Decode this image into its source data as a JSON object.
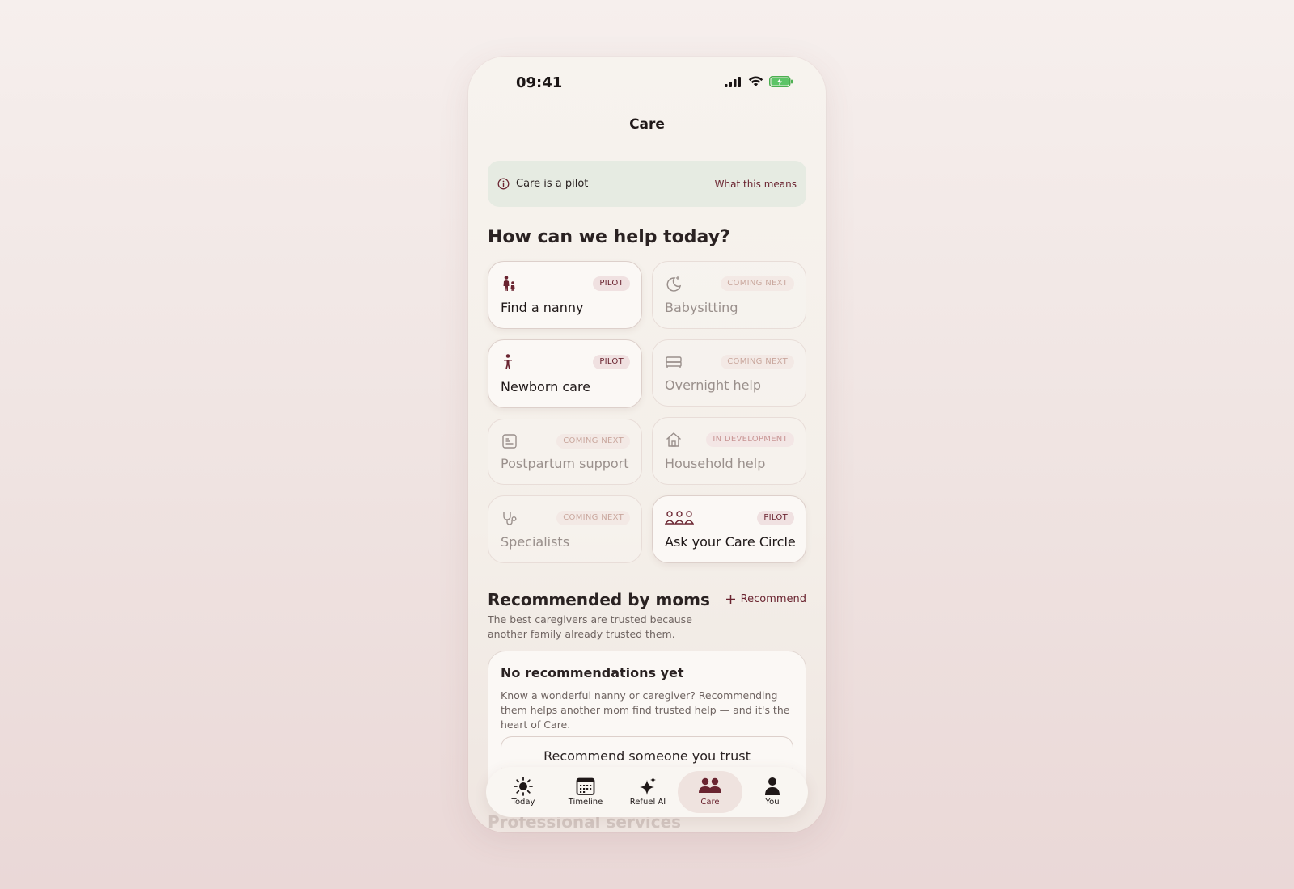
{
  "status_bar": {
    "time": "09:41"
  },
  "nav": {
    "title": "Care"
  },
  "banner": {
    "text": "Care is a pilot",
    "link": "What this means"
  },
  "help": {
    "heading": "How can we help today?",
    "cards": [
      {
        "label": "Find a nanny",
        "badge": "PILOT",
        "icon": "nanny-icon",
        "state": "active"
      },
      {
        "label": "Babysitting",
        "badge": "COMING NEXT",
        "icon": "moon-icon",
        "state": "muted"
      },
      {
        "label": "Newborn care",
        "badge": "PILOT",
        "icon": "newborn-icon",
        "state": "active"
      },
      {
        "label": "Overnight help",
        "badge": "COMING NEXT",
        "icon": "bed-icon",
        "state": "muted"
      },
      {
        "label": "Postpartum support",
        "badge": "COMING NEXT",
        "icon": "document-icon",
        "state": "muted"
      },
      {
        "label": "Household help",
        "badge": "IN DEVELOPMENT",
        "icon": "house-icon",
        "state": "muted"
      },
      {
        "label": "Specialists",
        "badge": "COMING NEXT",
        "icon": "stethoscope-icon",
        "state": "muted"
      },
      {
        "label": "Ask your Care Circle",
        "badge": "PILOT",
        "icon": "group-icon",
        "state": "active"
      }
    ]
  },
  "recommended": {
    "heading": "Recommended by moms",
    "subtitle": "The best caregivers are trusted because another family already trusted them.",
    "action": "Recommend",
    "empty_title": "No recommendations yet",
    "empty_body": "Know a wonderful nanny or caregiver? Recommending them helps another mom find trusted help — and it's the heart of Care.",
    "empty_button": "Recommend someone you trust"
  },
  "next_section": {
    "heading": "Professional services"
  },
  "tabs": [
    {
      "label": "Today",
      "icon": "sun-icon"
    },
    {
      "label": "Timeline",
      "icon": "calendar-icon"
    },
    {
      "label": "Refuel AI",
      "icon": "sparkle-icon"
    },
    {
      "label": "Care",
      "icon": "people-icon",
      "selected": true
    },
    {
      "label": "You",
      "icon": "person-icon"
    }
  ],
  "colors": {
    "accent": "#6a2430",
    "banner_bg": "#e6ebe2",
    "badge_pilot_bg": "#f0e1e1",
    "muted_text": "#9a908c",
    "tab_selected_bg": "#efe3df"
  }
}
